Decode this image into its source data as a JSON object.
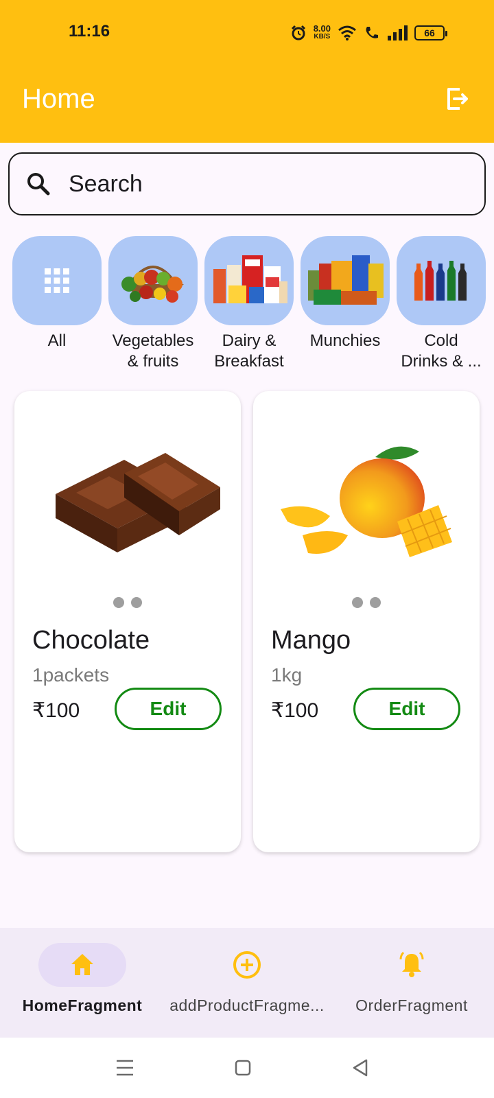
{
  "status_bar": {
    "time": "11:16",
    "net_speed_value": "8.00",
    "net_speed_unit": "KB/S",
    "battery": "66"
  },
  "app_bar": {
    "title": "Home",
    "logout_icon": "logout-icon"
  },
  "search": {
    "placeholder": "Search",
    "icon": "search-icon"
  },
  "categories": [
    {
      "label": "All",
      "icon": "grid-icon"
    },
    {
      "label": "Vegetables\n& fruits",
      "icon": "vegetables-image"
    },
    {
      "label": "Dairy &\nBreakfast",
      "icon": "dairy-image"
    },
    {
      "label": "Munchies",
      "icon": "munchies-image"
    },
    {
      "label": "Cold\nDrinks & ...",
      "icon": "cold-drinks-image"
    }
  ],
  "products": [
    {
      "name": "Chocolate",
      "quantity": "1packets",
      "price": "₹100",
      "edit_label": "Edit",
      "image": "chocolate-image",
      "image_count": 2
    },
    {
      "name": "Mango",
      "quantity": "1kg",
      "price": "₹100",
      "edit_label": "Edit",
      "image": "mango-image",
      "image_count": 2
    }
  ],
  "bottom_nav": [
    {
      "label": "HomeFragment",
      "icon": "home-icon",
      "active": true
    },
    {
      "label": "addProductFragme...",
      "icon": "add-circle-icon",
      "active": false
    },
    {
      "label": "OrderFragment",
      "icon": "bell-icon",
      "active": false
    }
  ],
  "colors": {
    "primary": "#ffbf10",
    "category_bg": "#aec8f6",
    "edit_green": "#138a13",
    "nav_active_pill": "#e6dcf6"
  }
}
